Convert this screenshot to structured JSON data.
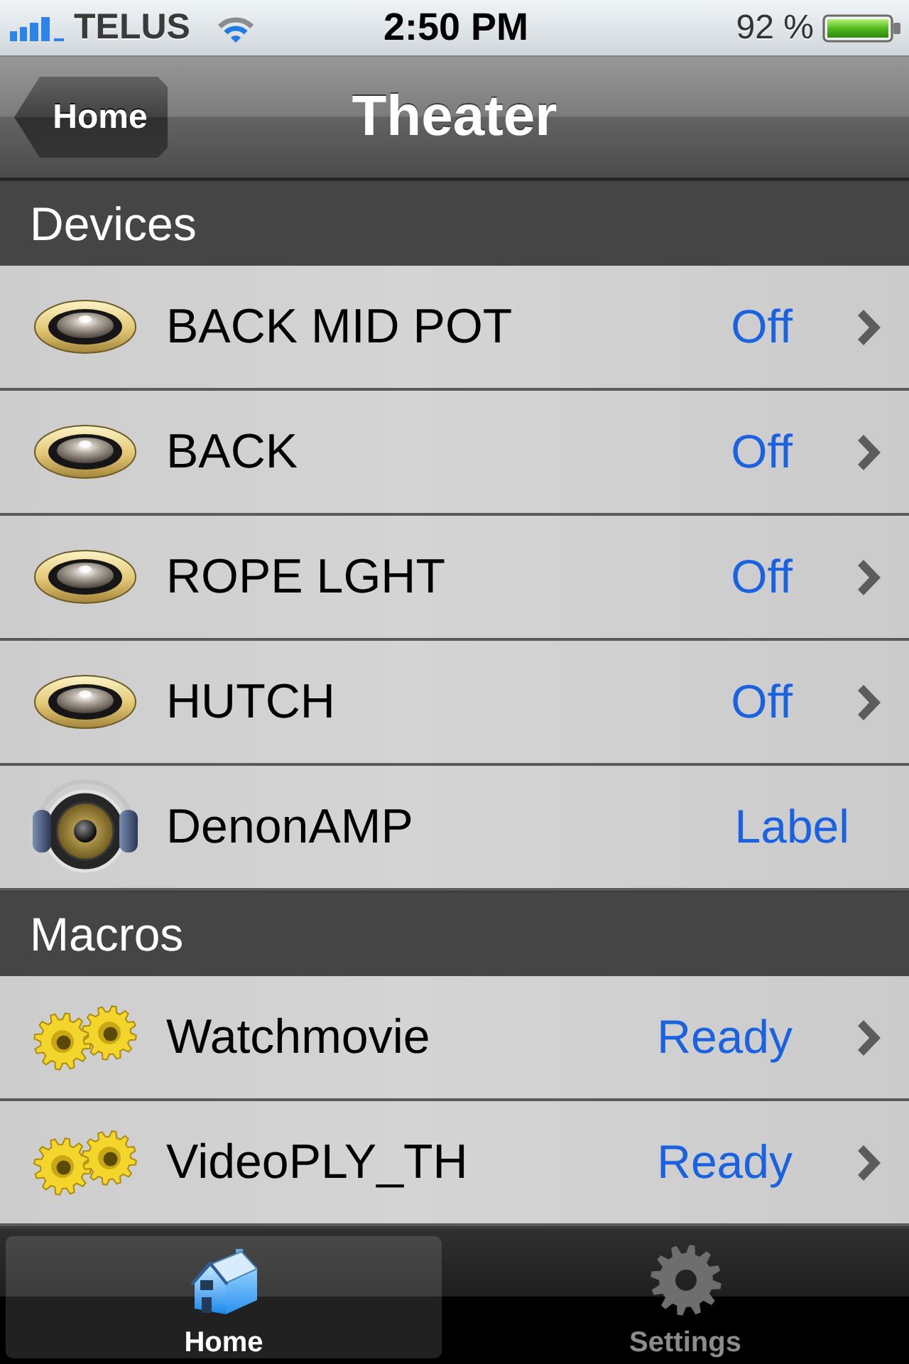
{
  "status_bar": {
    "carrier": "TELUS",
    "time": "2:50 PM",
    "battery": "92 %"
  },
  "nav_bar": {
    "back_button": "Home",
    "title": "Theater"
  },
  "sections": [
    {
      "title": "Devices",
      "rows": [
        {
          "kind": "light",
          "name": "BACK MID POT",
          "value": "Off",
          "disclosure": true
        },
        {
          "kind": "light",
          "name": "BACK",
          "value": "Off",
          "disclosure": true
        },
        {
          "kind": "light",
          "name": "ROPE LGHT",
          "value": "Off",
          "disclosure": true
        },
        {
          "kind": "light",
          "name": "HUTCH",
          "value": "Off",
          "disclosure": true
        },
        {
          "kind": "speaker",
          "name": "DenonAMP",
          "value": "Label",
          "disclosure": false
        }
      ]
    },
    {
      "title": "Macros",
      "rows": [
        {
          "kind": "macro",
          "name": "Watchmovie",
          "value": "Ready",
          "disclosure": true
        },
        {
          "kind": "macro",
          "name": "VideoPLY_TH",
          "value": "Ready",
          "disclosure": true
        }
      ]
    }
  ],
  "tab_bar": [
    {
      "kind": "home",
      "label": "Home",
      "selected": true
    },
    {
      "kind": "settings",
      "label": "Settings",
      "selected": false
    }
  ]
}
